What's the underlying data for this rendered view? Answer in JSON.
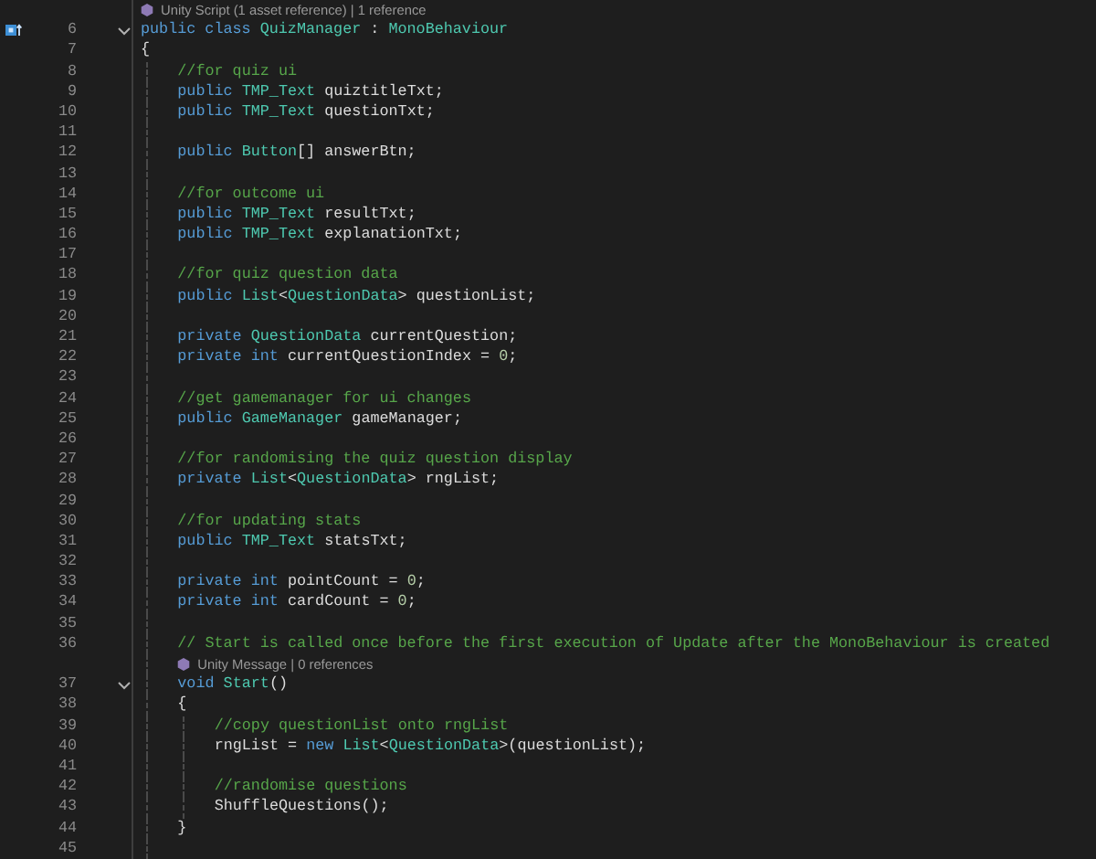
{
  "editor": {
    "rows": [
      {
        "kind": "codelens",
        "text": "Unity Script (1 asset reference) | 1 reference"
      },
      {
        "kind": "code",
        "number": "6",
        "marker": true,
        "expanded": true,
        "tokens": [
          {
            "kind": "kw",
            "text": "public class "
          },
          {
            "kind": "type",
            "text": "QuizManager"
          },
          {
            "kind": "id",
            "text": " : "
          },
          {
            "kind": "type",
            "text": "MonoBehaviour"
          }
        ]
      },
      {
        "kind": "code",
        "number": "7",
        "tokens": [
          {
            "kind": "id",
            "text": "{"
          }
        ]
      },
      {
        "kind": "code",
        "number": "8",
        "tokens": [
          {
            "kind": "cm",
            "text": "    //for quiz ui"
          }
        ]
      },
      {
        "kind": "code",
        "number": "9",
        "tokens": [
          {
            "kind": "kw",
            "text": "    public "
          },
          {
            "kind": "type",
            "text": "TMP_Text"
          },
          {
            "kind": "id",
            "text": " quiztitleTxt;"
          }
        ]
      },
      {
        "kind": "code",
        "number": "10",
        "tokens": [
          {
            "kind": "kw",
            "text": "    public "
          },
          {
            "kind": "type",
            "text": "TMP_Text"
          },
          {
            "kind": "id",
            "text": " questionTxt;"
          }
        ]
      },
      {
        "kind": "code",
        "number": "11",
        "tokens": []
      },
      {
        "kind": "code",
        "number": "12",
        "tokens": [
          {
            "kind": "kw",
            "text": "    public "
          },
          {
            "kind": "type",
            "text": "Button"
          },
          {
            "kind": "id",
            "text": "[] answerBtn;"
          }
        ]
      },
      {
        "kind": "code",
        "number": "13",
        "tokens": []
      },
      {
        "kind": "code",
        "number": "14",
        "tokens": [
          {
            "kind": "cm",
            "text": "    //for outcome ui"
          }
        ]
      },
      {
        "kind": "code",
        "number": "15",
        "tokens": [
          {
            "kind": "kw",
            "text": "    public "
          },
          {
            "kind": "type",
            "text": "TMP_Text"
          },
          {
            "kind": "id",
            "text": " resultTxt;"
          }
        ]
      },
      {
        "kind": "code",
        "number": "16",
        "tokens": [
          {
            "kind": "kw",
            "text": "    public "
          },
          {
            "kind": "type",
            "text": "TMP_Text"
          },
          {
            "kind": "id",
            "text": " explanationTxt;"
          }
        ]
      },
      {
        "kind": "code",
        "number": "17",
        "tokens": []
      },
      {
        "kind": "code",
        "number": "18",
        "tokens": [
          {
            "kind": "cm",
            "text": "    //for quiz question data"
          }
        ]
      },
      {
        "kind": "code",
        "number": "19",
        "tokens": [
          {
            "kind": "kw",
            "text": "    public "
          },
          {
            "kind": "type",
            "text": "List"
          },
          {
            "kind": "id",
            "text": "<"
          },
          {
            "kind": "type",
            "text": "QuestionData"
          },
          {
            "kind": "id",
            "text": "> questionList;"
          }
        ]
      },
      {
        "kind": "code",
        "number": "20",
        "tokens": []
      },
      {
        "kind": "code",
        "number": "21",
        "tokens": [
          {
            "kind": "kw",
            "text": "    private "
          },
          {
            "kind": "type",
            "text": "QuestionData"
          },
          {
            "kind": "id",
            "text": " currentQuestion;"
          }
        ]
      },
      {
        "kind": "code",
        "number": "22",
        "tokens": [
          {
            "kind": "kw",
            "text": "    private int "
          },
          {
            "kind": "id",
            "text": "currentQuestionIndex = "
          },
          {
            "kind": "num",
            "text": "0"
          },
          {
            "kind": "id",
            "text": ";"
          }
        ]
      },
      {
        "kind": "code",
        "number": "23",
        "tokens": []
      },
      {
        "kind": "code",
        "number": "24",
        "tokens": [
          {
            "kind": "cm",
            "text": "    //get gamemanager for ui changes"
          }
        ]
      },
      {
        "kind": "code",
        "number": "25",
        "tokens": [
          {
            "kind": "kw",
            "text": "    public "
          },
          {
            "kind": "type",
            "text": "GameManager"
          },
          {
            "kind": "id",
            "text": " gameManager;"
          }
        ]
      },
      {
        "kind": "code",
        "number": "26",
        "tokens": []
      },
      {
        "kind": "code",
        "number": "27",
        "tokens": [
          {
            "kind": "cm",
            "text": "    //for randomising the quiz question display"
          }
        ]
      },
      {
        "kind": "code",
        "number": "28",
        "tokens": [
          {
            "kind": "kw",
            "text": "    private "
          },
          {
            "kind": "type",
            "text": "List"
          },
          {
            "kind": "id",
            "text": "<"
          },
          {
            "kind": "type",
            "text": "QuestionData"
          },
          {
            "kind": "id",
            "text": "> rngList;"
          }
        ]
      },
      {
        "kind": "code",
        "number": "29",
        "tokens": []
      },
      {
        "kind": "code",
        "number": "30",
        "tokens": [
          {
            "kind": "cm",
            "text": "    //for updating stats"
          }
        ]
      },
      {
        "kind": "code",
        "number": "31",
        "tokens": [
          {
            "kind": "kw",
            "text": "    public "
          },
          {
            "kind": "type",
            "text": "TMP_Text"
          },
          {
            "kind": "id",
            "text": " statsTxt;"
          }
        ]
      },
      {
        "kind": "code",
        "number": "32",
        "tokens": []
      },
      {
        "kind": "code",
        "number": "33",
        "tokens": [
          {
            "kind": "kw",
            "text": "    private int "
          },
          {
            "kind": "id",
            "text": "pointCount = "
          },
          {
            "kind": "num",
            "text": "0"
          },
          {
            "kind": "id",
            "text": ";"
          }
        ]
      },
      {
        "kind": "code",
        "number": "34",
        "tokens": [
          {
            "kind": "kw",
            "text": "    private int "
          },
          {
            "kind": "id",
            "text": "cardCount = "
          },
          {
            "kind": "num",
            "text": "0"
          },
          {
            "kind": "id",
            "text": ";"
          }
        ]
      },
      {
        "kind": "code",
        "number": "35",
        "tokens": []
      },
      {
        "kind": "code",
        "number": "36",
        "tokens": [
          {
            "kind": "cm",
            "text": "    // Start is called once before the first execution of Update after the MonoBehaviour is created"
          }
        ]
      },
      {
        "kind": "codelens",
        "indented": true,
        "text": "Unity Message | 0 references"
      },
      {
        "kind": "code",
        "number": "37",
        "expanded": true,
        "tokens": [
          {
            "kind": "kw",
            "text": "    void "
          },
          {
            "kind": "type",
            "text": "Start"
          },
          {
            "kind": "id",
            "text": "()"
          }
        ]
      },
      {
        "kind": "code",
        "number": "38",
        "tokens": [
          {
            "kind": "id",
            "text": "    {"
          }
        ]
      },
      {
        "kind": "code",
        "number": "39",
        "tokens": [
          {
            "kind": "cm",
            "text": "        //copy questionList onto rngList"
          }
        ]
      },
      {
        "kind": "code",
        "number": "40",
        "tokens": [
          {
            "kind": "id",
            "text": "        rngList = "
          },
          {
            "kind": "kw",
            "text": "new "
          },
          {
            "kind": "type",
            "text": "List"
          },
          {
            "kind": "id",
            "text": "<"
          },
          {
            "kind": "type",
            "text": "QuestionData"
          },
          {
            "kind": "id",
            "text": ">(questionList);"
          }
        ]
      },
      {
        "kind": "code",
        "number": "41",
        "tokens": []
      },
      {
        "kind": "code",
        "number": "42",
        "tokens": [
          {
            "kind": "cm",
            "text": "        //randomise questions"
          }
        ]
      },
      {
        "kind": "code",
        "number": "43",
        "tokens": [
          {
            "kind": "id",
            "text": "        ShuffleQuestions();"
          }
        ]
      },
      {
        "kind": "code",
        "number": "44",
        "tokens": [
          {
            "kind": "id",
            "text": "    }"
          }
        ]
      },
      {
        "kind": "code",
        "number": "45",
        "tokens": []
      }
    ]
  }
}
